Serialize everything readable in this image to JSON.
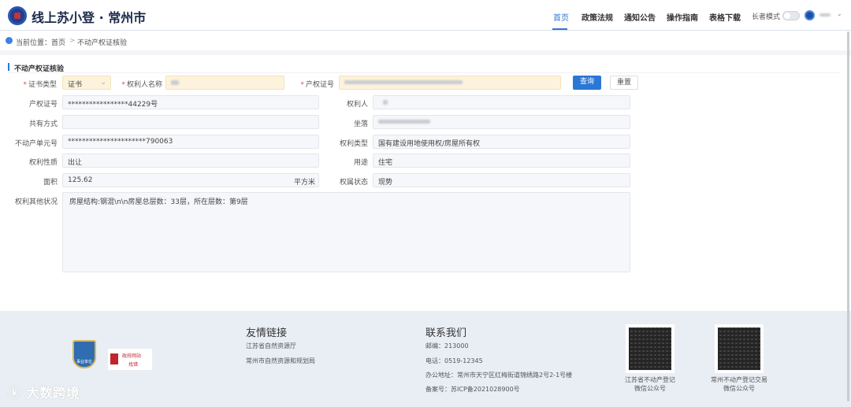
{
  "header": {
    "title": "线上苏小登 · 常州市",
    "nav": [
      "首页",
      "政策法规",
      "通知公告",
      "操作指南",
      "表格下载"
    ],
    "elder_mode": "长者模式",
    "elder_mode_on": false
  },
  "breadcrumb": {
    "prefix": "当前位置：",
    "home": "首页",
    "sep": ">",
    "current": "不动产权证核验"
  },
  "section": {
    "title": "不动产权证核验"
  },
  "search": {
    "cert_type_label": "证书类型",
    "cert_type_value": "证书",
    "owner_label": "权利人名称",
    "cert_no_label": "产权证号",
    "query": "查询",
    "reset": "重置"
  },
  "fields": {
    "cert_no": {
      "label": "产权证号",
      "value": "*****************44229号"
    },
    "owner": {
      "label": "权利人"
    },
    "share": {
      "label": "共有方式",
      "value": ""
    },
    "location": {
      "label": "坐落"
    },
    "unit_no": {
      "label": "不动产单元号",
      "value": "**********************790063"
    },
    "right_type": {
      "label": "权利类型",
      "value": "国有建设用地使用权/房屋所有权"
    },
    "nature": {
      "label": "权利性质",
      "value": "出让"
    },
    "usage": {
      "label": "用途",
      "value": "住宅"
    },
    "area": {
      "label": "面积",
      "value": "125.62",
      "unit": "平方米"
    },
    "status": {
      "label": "权属状态",
      "value": "现势"
    },
    "other": {
      "label": "权利其他状况",
      "value": "房屋结构:钢混\\n\\n房屋总层数：33层，所在层数：第9层"
    }
  },
  "footer": {
    "badge1": "事业单位",
    "badge2_line1": "政府网站",
    "badge2_line2": "找错",
    "links_title": "友情链接",
    "links": [
      "江苏省自然资源厅",
      "常州市自然资源和规划局"
    ],
    "contact_title": "联系我们",
    "contact": [
      "邮编：213000",
      "电话：0519-12345",
      "办公地址：常州市天宁区红梅街道锦绣路2号2-1号楼",
      "备案号：苏ICP备2021028900号"
    ],
    "qr1": [
      "江苏省不动产登记",
      "微信公众号"
    ],
    "qr2": [
      "常州不动产登记交易",
      "微信公众号"
    ],
    "watermark": "大数跨境"
  }
}
